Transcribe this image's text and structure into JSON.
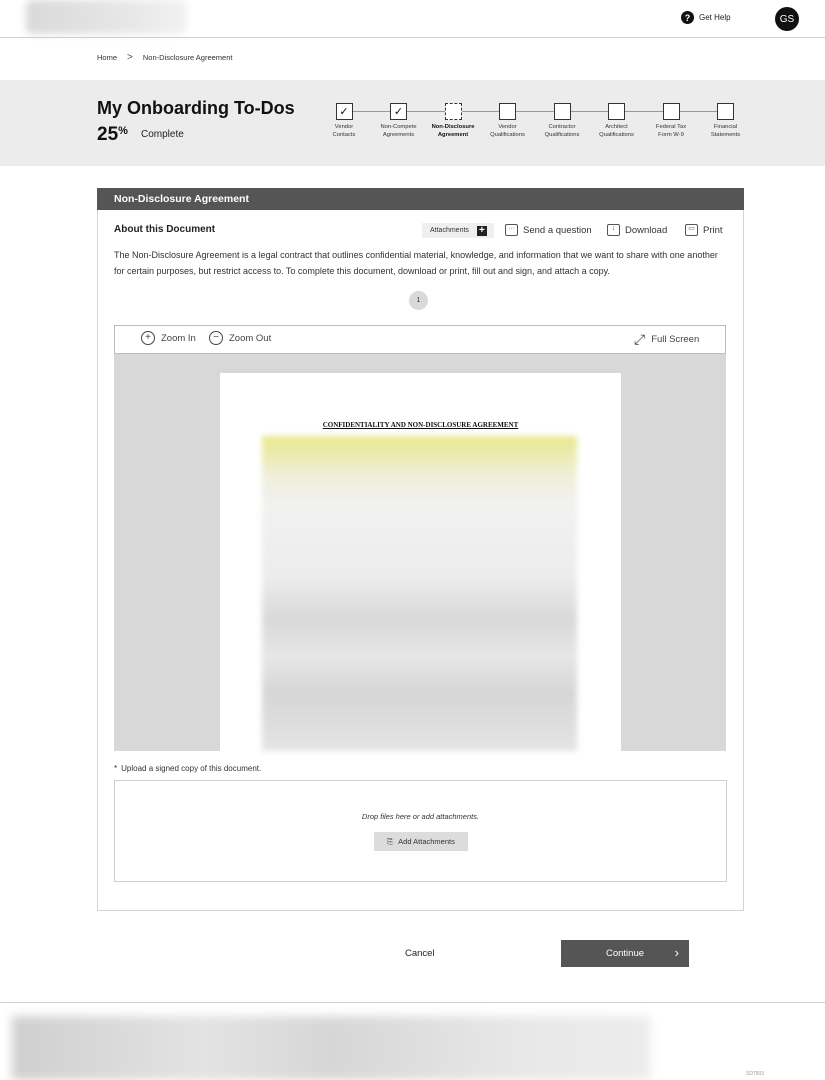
{
  "header": {
    "help_label": "Get Help",
    "help_icon": "?",
    "avatar_initials": "GS"
  },
  "breadcrumb": {
    "home": "Home",
    "separator": ">",
    "current": "Non-Disclosure Agreement"
  },
  "progress": {
    "title": "My Onboarding To-Dos",
    "percent": "25",
    "percent_symbol": "%",
    "complete_label": "Complete",
    "steps": [
      {
        "label_line1": "Vendor",
        "label_line2": "Contacts",
        "status": "complete"
      },
      {
        "label_line1": "Non-Compete",
        "label_line2": "Agreements",
        "status": "complete"
      },
      {
        "label_line1": "Non-Disclosure",
        "label_line2": "Agreement",
        "status": "current"
      },
      {
        "label_line1": "Vendor",
        "label_line2": "Qualifications",
        "status": "pending"
      },
      {
        "label_line1": "Contractor",
        "label_line2": "Qualifications",
        "status": "pending"
      },
      {
        "label_line1": "Architect",
        "label_line2": "Qualifications",
        "status": "pending"
      },
      {
        "label_line1": "Federal Tax",
        "label_line2": "Form W-9",
        "status": "pending"
      },
      {
        "label_line1": "Financial",
        "label_line2": "Statements",
        "status": "pending"
      }
    ]
  },
  "card": {
    "header": "Non-Disclosure Agreement",
    "about_title": "About this Document",
    "attachments_label": "Attachments",
    "attachments_icon": "+",
    "send_question_label": "Send a question",
    "download_label": "Download",
    "print_label": "Print",
    "description": "The Non-Disclosure Agreement is a legal contract that outlines confidential material, knowledge, and information that we want to share with one another for certain purposes, but restrict access to. To complete this document, download or print, fill out and sign, and attach a copy.",
    "page_number": "1"
  },
  "viewer": {
    "zoom_in_label": "Zoom In",
    "zoom_out_label": "Zoom Out",
    "full_screen_label": "Full Screen",
    "document_heading": "CONFIDENTIALITY AND NON-DISCLOSURE AGREEMENT"
  },
  "upload": {
    "note": "Upload a signed copy of this document.",
    "note_icon": "*",
    "drop_text": "Drop files here or add attachments.",
    "add_button": "Add Attachments"
  },
  "actions": {
    "cancel": "Cancel",
    "continue": "Continue"
  },
  "footer": {
    "code": "SD7503"
  },
  "colors": {
    "banner_bg": "#ececec",
    "card_header_bg": "#555555",
    "continue_bg": "#555555",
    "viewer_bg": "#d8d8d8"
  }
}
